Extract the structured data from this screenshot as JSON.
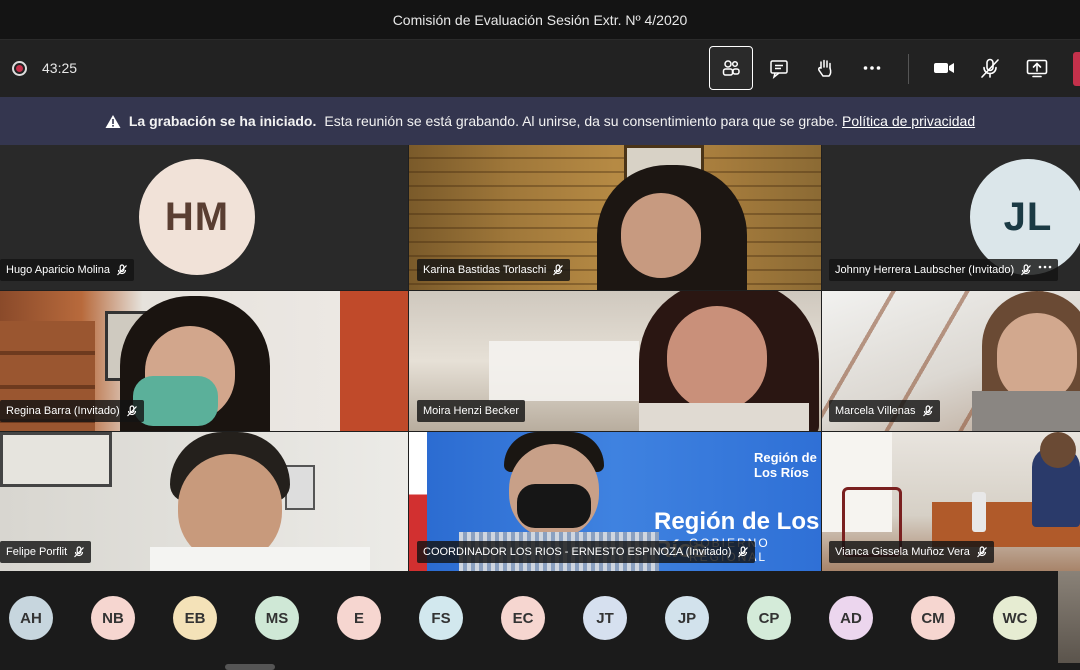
{
  "window": {
    "title": "Comisión de Evaluación Sesión Extr. Nº 4/2020"
  },
  "toolbar": {
    "elapsed": "43:25",
    "buttons": [
      "participants-icon",
      "chat-icon",
      "raise-hand-icon",
      "more-icon",
      "camera-icon",
      "mic-muted-icon",
      "share-screen-icon"
    ]
  },
  "banner": {
    "title": "La grabación se ha iniciado.",
    "message": "Esta reunión se está grabando. Al unirse, da su consentimiento para que se grabe.",
    "link": "Política de privacidad"
  },
  "tiles": [
    {
      "name": "Hugo Aparicio Molina",
      "initials": "HM",
      "avatar_color": "#f1e2d8",
      "text_color": "#5a3e32"
    },
    {
      "name": "Karina Bastidas Torlaschi"
    },
    {
      "name": "Johnny Herrera Laubscher (Invitado)",
      "initials": "JL",
      "avatar_color": "#dbe6ea",
      "text_color": "#1b3a44"
    },
    {
      "name": "Regina Barra (Invitado)"
    },
    {
      "name": "Moira Henzi Becker"
    },
    {
      "name": "Marcela Villenas"
    },
    {
      "name": "Felipe Porflit"
    },
    {
      "name": "COORDINADOR LOS RIOS - ERNESTO ESPINOZA (Invitado)"
    },
    {
      "name": "Vianca Gissela Muñoz Vera"
    }
  ],
  "background_signage": {
    "region_text": "Región de Los Ríos",
    "subtitle": "GOBIERNO REGIONAL"
  },
  "roster": [
    {
      "initials": "AH",
      "color": "#c7d6de"
    },
    {
      "initials": "NB",
      "color": "#f6d6d0"
    },
    {
      "initials": "EB",
      "color": "#f4e2b8"
    },
    {
      "initials": "MS",
      "color": "#cfe8d6"
    },
    {
      "initials": "E",
      "color": "#f6d6d0"
    },
    {
      "initials": "FS",
      "color": "#d2e8ee"
    },
    {
      "initials": "EC",
      "color": "#f6d6d0"
    },
    {
      "initials": "JT",
      "color": "#d6e0ef"
    },
    {
      "initials": "JP",
      "color": "#d2e2ec"
    },
    {
      "initials": "CP",
      "color": "#d4ebd9"
    },
    {
      "initials": "AD",
      "color": "#ecd6ee"
    },
    {
      "initials": "CM",
      "color": "#f6d6d0"
    },
    {
      "initials": "WC",
      "color": "#e6ecd2"
    }
  ]
}
